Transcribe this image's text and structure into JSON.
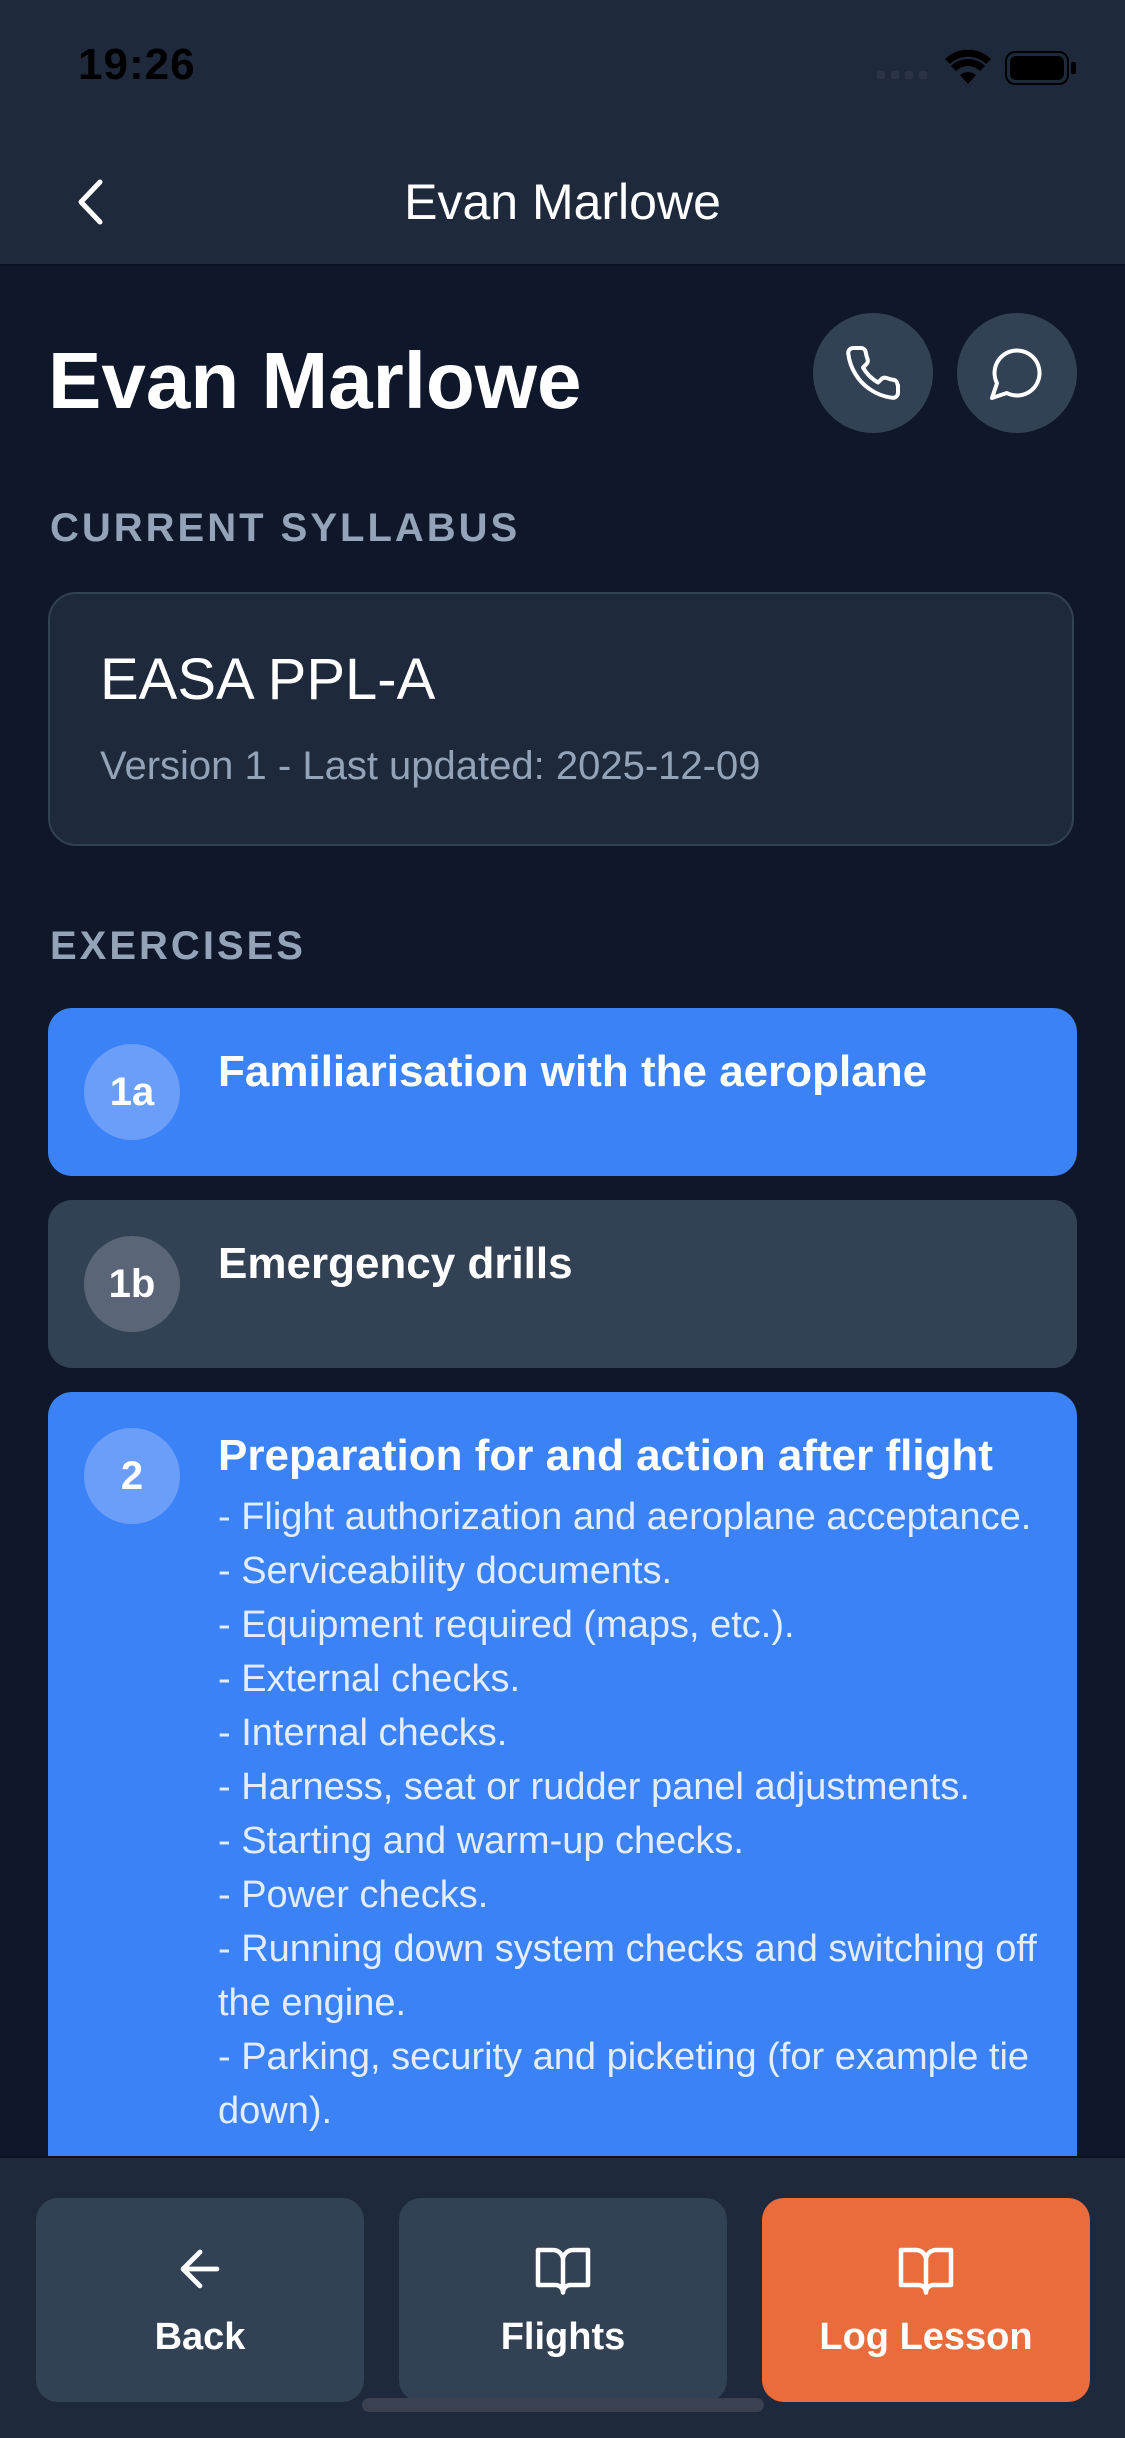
{
  "status": {
    "time": "19:26"
  },
  "nav": {
    "title": "Evan Marlowe"
  },
  "student": {
    "name": "Evan Marlowe"
  },
  "syllabus": {
    "section_label": "CURRENT SYLLABUS",
    "name": "EASA PPL-A",
    "meta": "Version 1 - Last updated: 2025-12-09"
  },
  "exercises": {
    "section_label": "EXERCISES",
    "items": [
      {
        "id": "1a",
        "title": "Familiarisation with the aeroplane",
        "selected": true,
        "description": ""
      },
      {
        "id": "1b",
        "title": "Emergency drills",
        "selected": false,
        "description": ""
      },
      {
        "id": "2",
        "title": "Preparation for and action after flight",
        "selected": true,
        "description": "- Flight authorization and aeroplane acceptance.\n- Serviceability documents.\n- Equipment required (maps, etc.).\n- External checks.\n- Internal checks.\n- Harness, seat or rudder panel adjustments.\n- Starting and warm-up checks.\n- Power checks.\n- Running down system checks and switching off the engine.\n- Parking, security and picketing (for example tie down)."
      }
    ]
  },
  "tabs": {
    "back": "Back",
    "flights": "Flights",
    "log_lesson": "Log Lesson"
  },
  "icons": {
    "phone": "phone-icon",
    "message": "message-icon",
    "back": "arrow-left-icon",
    "book": "book-open-icon"
  },
  "colors": {
    "background": "#0f172a",
    "surface": "#1e293b",
    "card": "#334155",
    "accent": "#3b82f6",
    "primary_action": "#ea6b3b"
  }
}
